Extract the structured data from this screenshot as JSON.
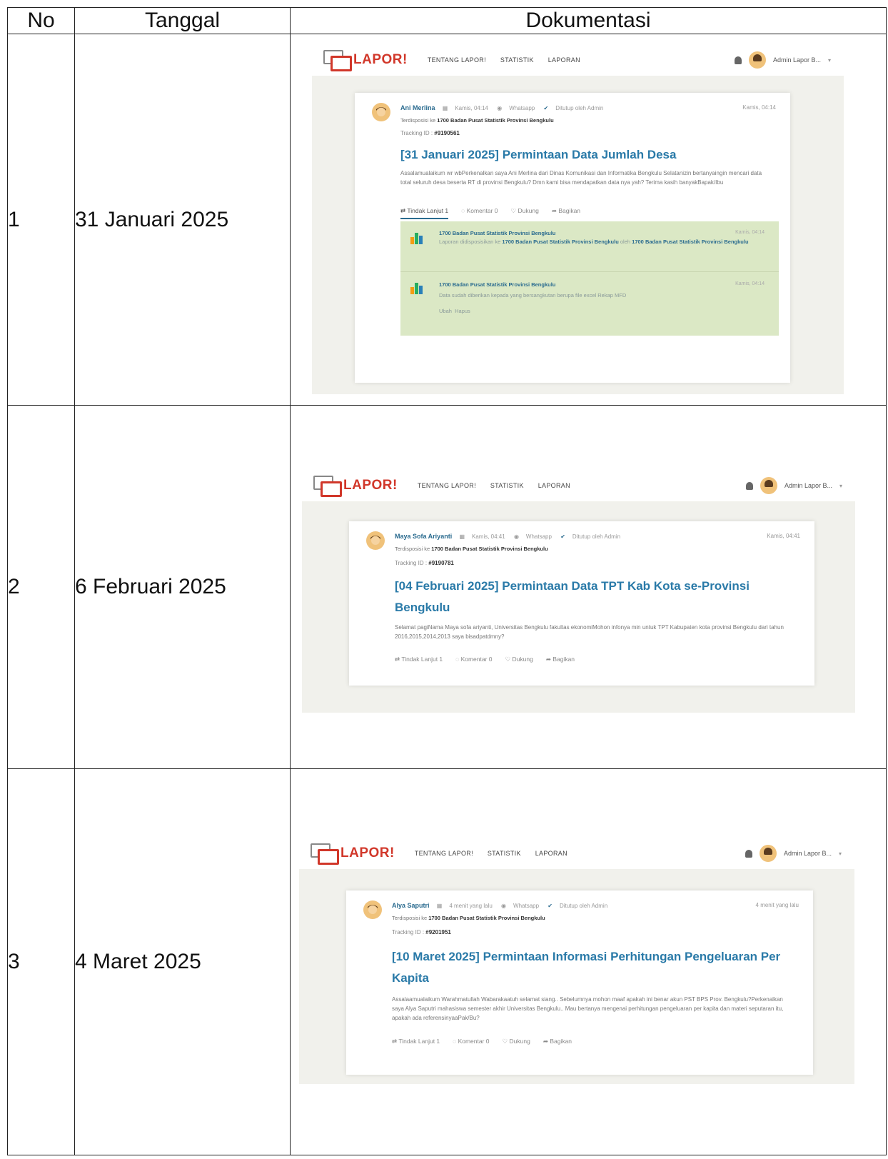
{
  "table": {
    "headers": {
      "no": "No",
      "date": "Tanggal",
      "doc": "Dokumentasi"
    },
    "rows": [
      {
        "no": "1",
        "date": "31 Januari 2025"
      },
      {
        "no": "2",
        "date": "6 Februari 2025"
      },
      {
        "no": "3",
        "date": "4 Maret 2025"
      }
    ]
  },
  "app": {
    "logo": "LAPOR!",
    "menu": [
      "TENTANG LAPOR!",
      "STATISTIK",
      "LAPORAN"
    ],
    "user": "Admin Lapor B...",
    "icons": [
      "logo-icon",
      "bell-icon",
      "user-avatar-icon",
      "calendar-icon",
      "whatsapp-icon",
      "check-icon",
      "follow-up-icon",
      "comment-icon",
      "support-icon",
      "share-icon",
      "bps-logo-icon"
    ]
  },
  "reports": [
    {
      "name": "Ani Merlina",
      "date": "Kamis, 04:14",
      "channel": "Whatsapp",
      "status": "Ditutup oleh Admin",
      "time": "Kamis, 04:14",
      "disposisi_prefix": "Terdisposisi ke",
      "disposisi": "1700 Badan Pusat Statistik Provinsi Bengkulu",
      "tracking_label": "Tracking ID :",
      "tracking": "#9190561",
      "title": "[31 Januari 2025] Permintaan Data Jumlah Desa",
      "body": "Assalamualaikum wr wbPerkenalkan saya Ani Merlina dari Dinas Komunikasi dan Informatika Bengkulu Selatanizin bertanyaingin mencari data total seluruh desa beserta RT di provinsi Bengkulu? Dmn kami bisa mendapatkan data nya yah? Terima kasih banyakBapak/Ibu",
      "actions": [
        "Tindak Lanjut 1",
        "Komentar 0",
        "Dukung",
        "Bagikan"
      ],
      "responses": [
        {
          "name": "1700 Badan Pusat Statistik Provinsi Bengkulu",
          "time": "Kamis, 04:14",
          "prefix": "Laporan didisposisikan ke",
          "target": "1700 Badan Pusat Statistik Provinsi Bengkulu",
          "mid": "oleh",
          "by": "1700 Badan Pusat Statistik Provinsi Bengkulu"
        },
        {
          "name": "1700 Badan Pusat Statistik Provinsi Bengkulu",
          "time": "Kamis, 04:14",
          "text": "Data sudah diberikan kepada yang bersangkutan berupa file excel Rekap MFD",
          "edit": "Ubah",
          "delete": "Hapus"
        }
      ]
    },
    {
      "name": "Maya Sofa Ariyanti",
      "date": "Kamis, 04:41",
      "channel": "Whatsapp",
      "status": "Ditutup oleh Admin",
      "time": "Kamis, 04:41",
      "disposisi_prefix": "Terdisposisi ke",
      "disposisi": "1700 Badan Pusat Statistik Provinsi Bengkulu",
      "tracking_label": "Tracking ID :",
      "tracking": "#9190781",
      "title": "[04 Februari 2025] Permintaan Data TPT Kab Kota se-Provinsi Bengkulu",
      "body": "Selamat pagiNama Maya sofa ariyanti, Universitas Bengkulu fakultas ekonomiMohon infonya min untuk TPT Kabupaten kota provinsi Bengkulu dari tahun 2016,2015,2014,2013 saya bisadpatdmny?",
      "actions": [
        "Tindak Lanjut 1",
        "Komentar 0",
        "Dukung",
        "Bagikan"
      ]
    },
    {
      "name": "Alya Saputri",
      "date": "4 menit yang lalu",
      "channel": "Whatsapp",
      "status": "Ditutup oleh Admin",
      "time": "4 menit yang lalu",
      "disposisi_prefix": "Terdisposisi ke",
      "disposisi": "1700 Badan Pusat Statistik Provinsi Bengkulu",
      "tracking_label": "Tracking ID :",
      "tracking": "#9201951",
      "title": "[10 Maret 2025] Permintaan Informasi Perhitungan Pengeluaran Per Kapita",
      "body": "Assalaamualaikum Warahmatullah Wabarakaatuh selamat siang.. Sebelumnya mohon maaf apakah ini benar akun PST BPS Prov. Bengkulu?Perkenalkan saya Alya Saputri mahasiswa semester akhir Universitas Bengkulu.. Mau bertanya mengenai perhitungan pengeluaran per kapita dan materi seputaran itu, apakah ada referensinyaaPak/Bu?",
      "actions": [
        "Tindak Lanjut 1",
        "Komentar 0",
        "Dukung",
        "Bagikan"
      ]
    }
  ]
}
